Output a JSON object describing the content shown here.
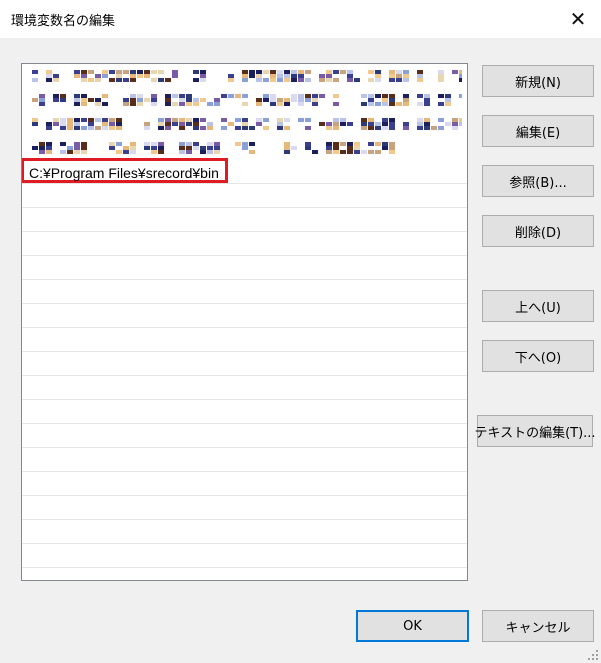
{
  "window": {
    "title": "環境変数名の編集",
    "close_glyph": "✕"
  },
  "list": {
    "highlight_color": "#e01b24",
    "entries": [
      {
        "text": "",
        "obscured": true
      },
      {
        "text": "",
        "obscured": true
      },
      {
        "text": "",
        "obscured": true
      },
      {
        "text": "",
        "obscured": true
      },
      {
        "text": "C:¥Program Files¥srecord¥bin",
        "obscured": false,
        "highlighted": true
      }
    ]
  },
  "buttons": {
    "new": "新規(N)",
    "edit": "編集(E)",
    "browse": "参照(B)...",
    "delete": "削除(D)",
    "move_up": "上へ(U)",
    "move_down": "下へ(O)",
    "edit_text": "テキストの編集(T)...",
    "ok": "OK",
    "cancel": "キャンセル"
  }
}
